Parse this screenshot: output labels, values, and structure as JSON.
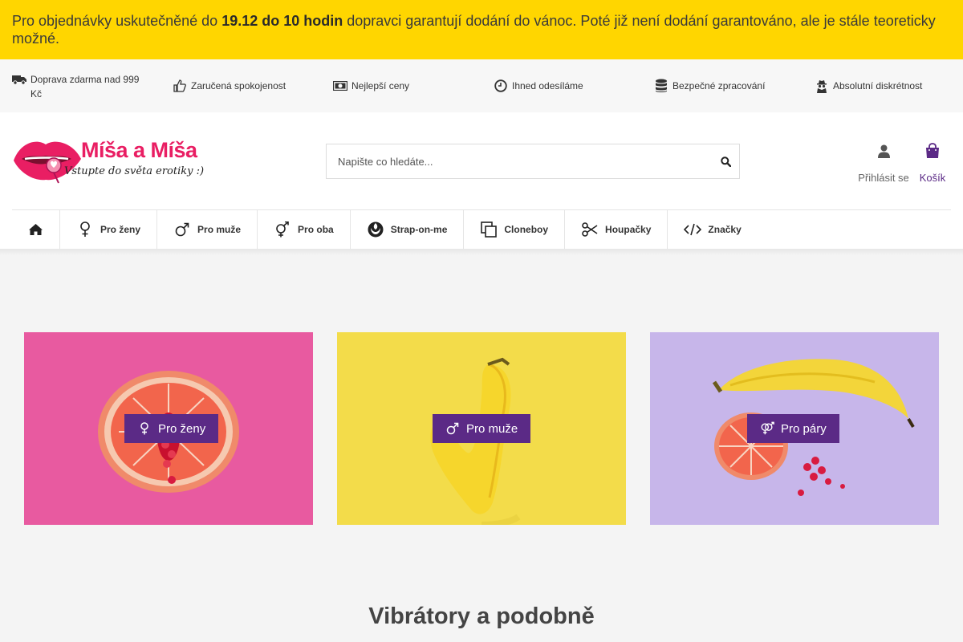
{
  "announcement": {
    "prefix": "Pro objednávky uskutečněné do ",
    "highlight": "19.12 do 10 hodin",
    "suffix": " dopravci garantují dodání do vánoc. Poté již není dodání garantováno, ale je stále teoreticky možné."
  },
  "benefits": [
    {
      "icon": "truck-icon",
      "label": "Doprava zdarma nad 999 Kč"
    },
    {
      "icon": "thumbs-up-icon",
      "label": "Zaručená spokojenost"
    },
    {
      "icon": "money-icon",
      "label": "Nejlepší ceny"
    },
    {
      "icon": "clock-icon",
      "label": "Ihned odesíláme"
    },
    {
      "icon": "database-icon",
      "label": "Bezpečné zpracování"
    },
    {
      "icon": "user-secret-icon",
      "label": "Absolutní diskrétnost"
    }
  ],
  "logo": {
    "title": "Míša a Míša",
    "tagline": "Vstupte do světa erotiky :)"
  },
  "search": {
    "placeholder": "Napište co hledáte...",
    "value": ""
  },
  "account": {
    "login_label": "Přihlásit se",
    "cart_label": "Košík"
  },
  "nav": [
    {
      "icon": "home-icon",
      "label": ""
    },
    {
      "icon": "female-icon",
      "label": "Pro ženy"
    },
    {
      "icon": "male-icon",
      "label": "Pro muže"
    },
    {
      "icon": "genderless-icon",
      "label": "Pro oba"
    },
    {
      "icon": "rebel-icon",
      "label": "Strap-on-me"
    },
    {
      "icon": "clone-icon",
      "label": "Cloneboy"
    },
    {
      "icon": "scissors-icon",
      "label": "Houpačky"
    },
    {
      "icon": "code-icon",
      "label": "Značky"
    }
  ],
  "tiles": [
    {
      "icon": "female-icon",
      "label": "Pro ženy"
    },
    {
      "icon": "male-icon",
      "label": "Pro muže"
    },
    {
      "icon": "mars-venus-icon",
      "label": "Pro páry"
    }
  ],
  "section": {
    "title": "Vibrátory a podobně"
  },
  "colors": {
    "announcement_bg": "#ffd600",
    "brand_purple": "#5b2a86",
    "logo_pink": "#e91e63",
    "tile_pink": "#e85aa0",
    "tile_yellow": "#f3dc4a",
    "tile_lavender": "#c7b6ea"
  }
}
